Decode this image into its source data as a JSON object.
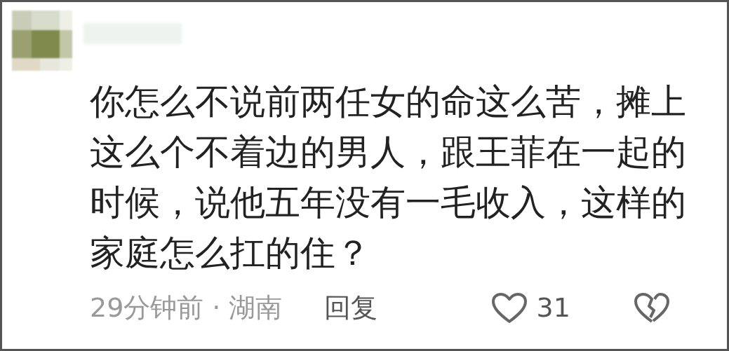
{
  "comment": {
    "text": "你怎么不说前两任女的命这么苦，摊上这么个不着边的男人，跟王菲在一起的时候，说他五年没有一毛收入，这样的家庭怎么扛的住？",
    "time": "29分钟前",
    "separator": "·",
    "location": "湖南",
    "reply": "回复",
    "likes": "31",
    "liked": false
  }
}
